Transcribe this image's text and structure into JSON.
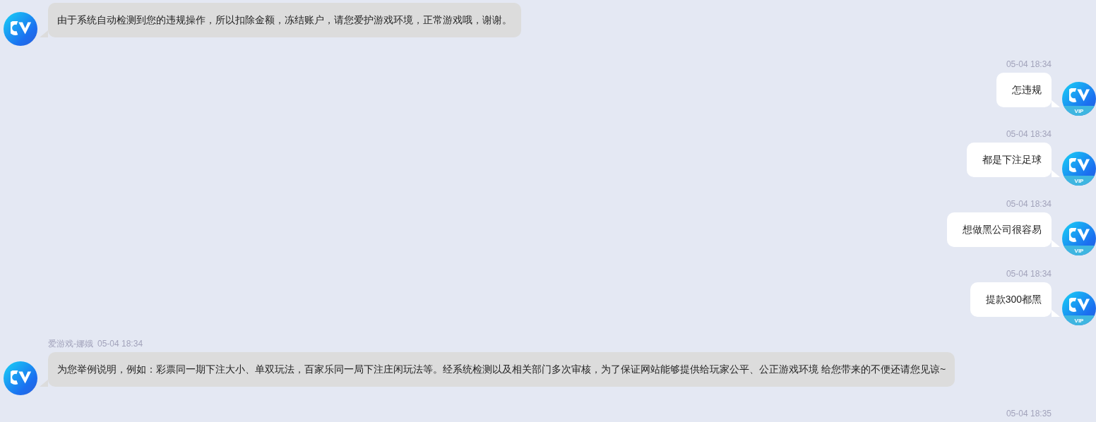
{
  "messages": [
    {
      "kind": "incoming",
      "text": "由于系统自动检测到您的违规操作，所以扣除金额，冻结账户，请您爱护游戏环境，正常游戏哦，谢谢。"
    },
    {
      "kind": "outgoing",
      "time": "05-04 18:34",
      "text": "怎违规",
      "badge": "VIP"
    },
    {
      "kind": "outgoing",
      "time": "05-04 18:34",
      "text": "都是下注足球",
      "badge": "VIP"
    },
    {
      "kind": "outgoing",
      "time": "05-04 18:34",
      "text": "想做黑公司很容易",
      "badge": "VIP"
    },
    {
      "kind": "outgoing",
      "time": "05-04 18:34",
      "text": "提款300都黑",
      "badge": "VIP"
    },
    {
      "kind": "incoming",
      "sender": "爱游戏-娜娥",
      "time": "05-04 18:34",
      "text": "为您举例说明，例如：彩票同一期下注大小、单双玩法，百家乐同一局下注庄闲玩法等。经系统检测以及相关部门多次审核，为了保证网站能够提供给玩家公平、公正游戏环境 给您带来的不便还请您见谅~"
    },
    {
      "kind": "outgoing",
      "time": "05-04 18:35"
    }
  ]
}
